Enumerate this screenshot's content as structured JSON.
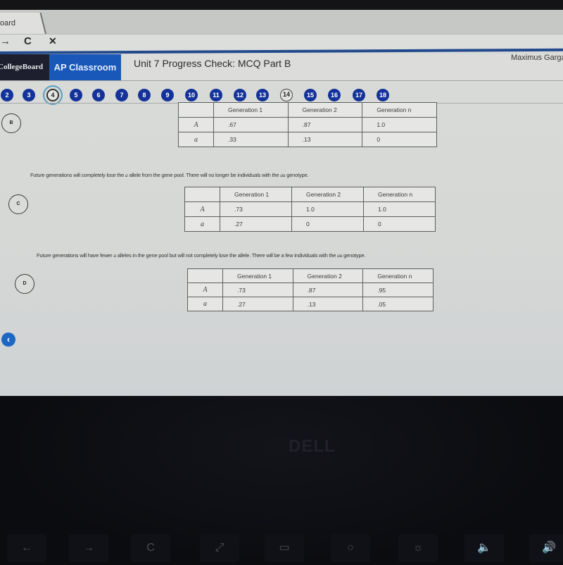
{
  "browser": {
    "tab_title": "oard",
    "forward_icon": "→",
    "reload_icon": "C",
    "stop_icon": "✕"
  },
  "header": {
    "brand": "CollegeBoard",
    "app_name": "AP Classroom",
    "page_title": "Unit 7 Progress Check: MCQ Part B",
    "user_name": "Maximus Garga",
    "accent_color": "#1958b9"
  },
  "question_nav": {
    "current": "4",
    "items": [
      {
        "label": "2",
        "state": "answered"
      },
      {
        "label": "3",
        "state": "answered"
      },
      {
        "label": "4",
        "state": "current"
      },
      {
        "label": "5",
        "state": "answered"
      },
      {
        "label": "6",
        "state": "answered"
      },
      {
        "label": "7",
        "state": "answered"
      },
      {
        "label": "8",
        "state": "answered"
      },
      {
        "label": "9",
        "state": "answered"
      },
      {
        "label": "10",
        "state": "answered"
      },
      {
        "label": "11",
        "state": "answered"
      },
      {
        "label": "12",
        "state": "answered"
      },
      {
        "label": "13",
        "state": "answered"
      },
      {
        "label": "14",
        "state": "unanswered"
      },
      {
        "label": "15",
        "state": "answered"
      },
      {
        "label": "16",
        "state": "answered"
      },
      {
        "label": "17",
        "state": "answered"
      },
      {
        "label": "18",
        "state": "answered"
      }
    ]
  },
  "choices": {
    "B": {
      "letter": "B",
      "text": "",
      "table": {
        "headers": [
          "",
          "Generation 1",
          "Generation 2",
          "Generation n"
        ],
        "rows": [
          {
            "label": "A",
            "values": [
              ".67",
              ".87",
              "1.0"
            ]
          },
          {
            "label": "a",
            "values": [
              ".33",
              ".13",
              "0"
            ]
          }
        ]
      }
    },
    "C": {
      "letter": "C",
      "text_parts": [
        "Future generations will completely lose the ",
        "a",
        " allele from the gene pool. There will no longer be individuals with the ",
        "aa",
        " genotype."
      ],
      "table": {
        "headers": [
          "",
          "Generation 1",
          "Generation 2",
          "Generation n"
        ],
        "rows": [
          {
            "label": "A",
            "values": [
              ".73",
              "1.0",
              "1.0"
            ]
          },
          {
            "label": "a",
            "values": [
              ".27",
              "0",
              "0"
            ]
          }
        ]
      }
    },
    "D": {
      "letter": "D",
      "text_parts": [
        "Future generations will have fewer ",
        "a",
        " alleles in the gene pool but will not completely lose the allele. There will be a few individuals with the ",
        "aa",
        " genotype."
      ],
      "table": {
        "headers": [
          "",
          "Generation 1",
          "Generation 2",
          "Generation n"
        ],
        "rows": [
          {
            "label": "A",
            "values": [
              ".73",
              ".87",
              ".95"
            ]
          },
          {
            "label": "a",
            "values": [
              ".27",
              ".13",
              ".05"
            ]
          }
        ]
      }
    }
  },
  "back_button": {
    "icon": "‹"
  },
  "device": {
    "logo": "DELL",
    "function_keys": [
      "←",
      "→",
      "C",
      "⤢",
      "▭",
      "○",
      "☼",
      "🔈",
      "🔊"
    ]
  }
}
